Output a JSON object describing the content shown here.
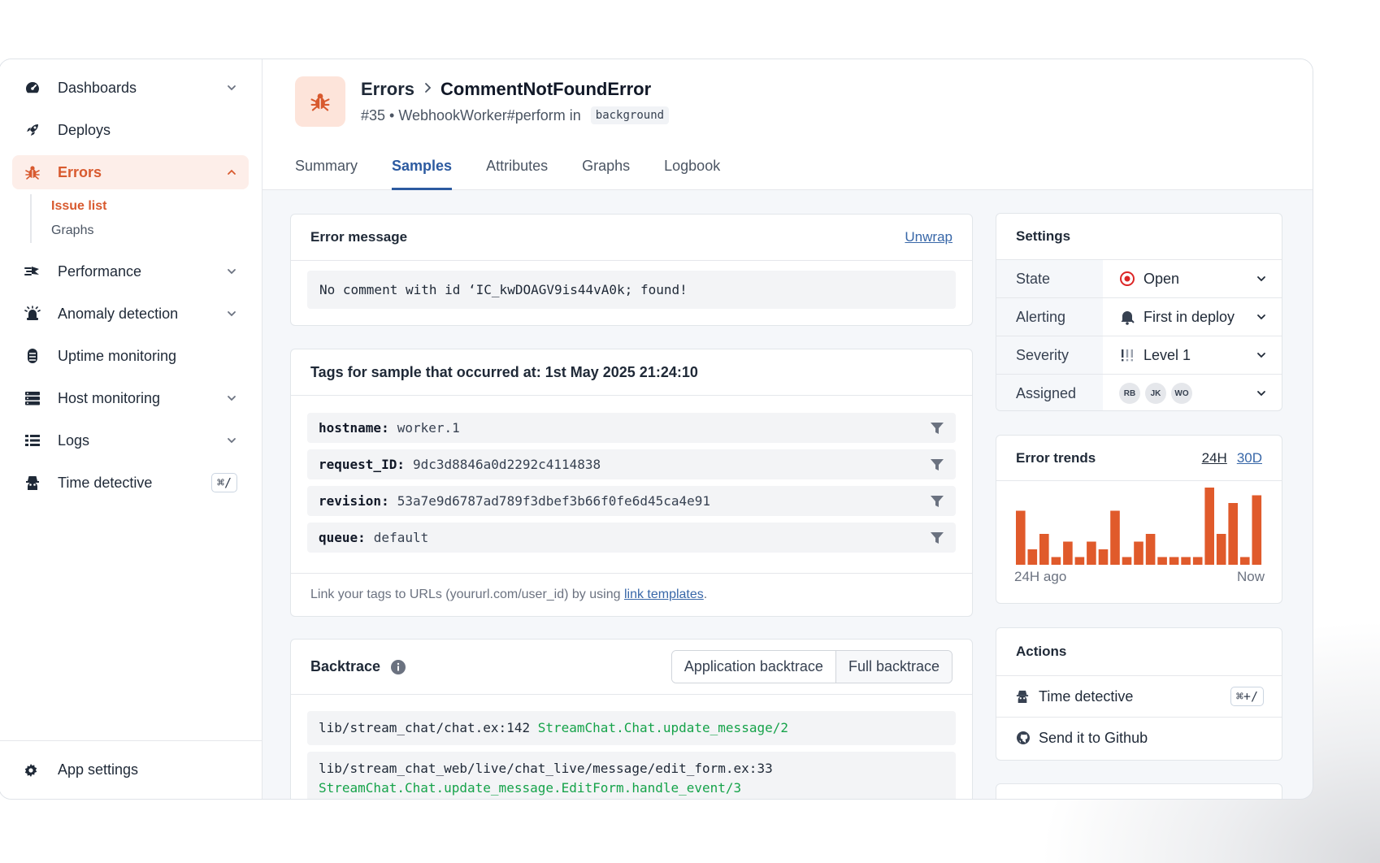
{
  "sidebar": {
    "items": [
      {
        "label": "Dashboards",
        "icon": "gauge-icon"
      },
      {
        "label": "Deploys",
        "icon": "rocket-icon"
      },
      {
        "label": "Errors",
        "icon": "bug-icon"
      },
      {
        "label": "Performance",
        "icon": "performance-icon"
      },
      {
        "label": "Anomaly detection",
        "icon": "siren-icon"
      },
      {
        "label": "Uptime monitoring",
        "icon": "heartbeat-icon"
      },
      {
        "label": "Host monitoring",
        "icon": "server-icon"
      },
      {
        "label": "Logs",
        "icon": "list-icon"
      },
      {
        "label": "Time detective",
        "icon": "detective-icon",
        "shortcut": "⌘/"
      }
    ],
    "errors_sub": [
      "Issue list",
      "Graphs"
    ],
    "footer": "App settings"
  },
  "header": {
    "crumb_parent": "Errors",
    "crumb_current": "CommentNotFoundError",
    "subline": "#35 • WebhookWorker#perform in",
    "namespace": "background"
  },
  "tabs": [
    "Summary",
    "Samples",
    "Attributes",
    "Graphs",
    "Logbook"
  ],
  "error_message": {
    "title": "Error message",
    "action": "Unwrap",
    "text": "No comment with id ‘IC_kwDOAGV9is44vA0k; found!"
  },
  "tags": {
    "title": "Tags for sample that occurred at: 1st May 2025 21:24:10",
    "rows": [
      {
        "key": "hostname:",
        "value": "worker.1"
      },
      {
        "key": "request_ID:",
        "value": "9dc3d8846a0d2292c4114838"
      },
      {
        "key": "revision:",
        "value": "53a7e9d6787ad789f3dbef3b66f0fe6d45ca4e91"
      },
      {
        "key": "queue:",
        "value": "default"
      }
    ],
    "footer_text": "Link your tags to URLs (yoururl.com/user_id) by using",
    "footer_link": "link templates",
    "footer_end": "."
  },
  "backtrace": {
    "title": "Backtrace",
    "toggle": [
      "Application backtrace",
      "Full backtrace"
    ],
    "lines": [
      {
        "path": "lib/stream_chat/chat.ex:142",
        "fn": "StreamChat.Chat.update_message/2"
      },
      {
        "path": "lib/stream_chat_web/live/chat_live/message/edit_form.ex:33",
        "fn": "StreamChat.Chat.update_message.EditForm.handle_event/3"
      }
    ]
  },
  "settings": {
    "title": "Settings",
    "rows": [
      {
        "label": "State",
        "value": "Open"
      },
      {
        "label": "Alerting",
        "value": "First in deploy"
      },
      {
        "label": "Severity",
        "value": "Level 1"
      },
      {
        "label": "Assigned",
        "avatars": [
          "RB",
          "JK",
          "WO"
        ]
      }
    ]
  },
  "trends": {
    "title": "Error trends",
    "ranges": [
      "24H",
      "30D"
    ],
    "start_label": "24H ago",
    "end_label": "Now"
  },
  "chart_data": {
    "type": "bar",
    "values": [
      7,
      2,
      4,
      1,
      3,
      1,
      3,
      2,
      7,
      1,
      3,
      4,
      1,
      1,
      1,
      1,
      10,
      4,
      8,
      1,
      9
    ],
    "color": "#e05a2b"
  },
  "actions": {
    "title": "Actions",
    "rows": [
      {
        "label": "Time detective",
        "shortcut": "⌘+/"
      },
      {
        "label": "Send it to Github"
      }
    ]
  },
  "colors": {
    "accent": "#d85a2f",
    "link": "#3867a8",
    "code_fn": "#16a34a"
  }
}
